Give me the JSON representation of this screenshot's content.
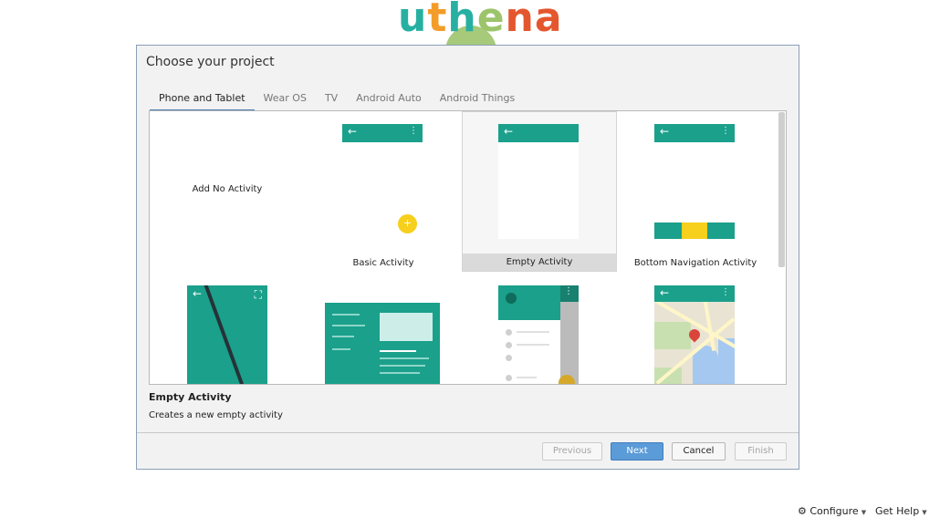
{
  "brand": {
    "letters": [
      {
        "ch": "u",
        "color": "#27b0a2"
      },
      {
        "ch": "t",
        "color": "#f39c2a"
      },
      {
        "ch": "h",
        "color": "#27b0a2"
      },
      {
        "ch": "e",
        "color": "#9cc46a"
      },
      {
        "ch": "n",
        "color": "#e4572e"
      },
      {
        "ch": "a",
        "color": "#e4572e"
      }
    ]
  },
  "dialog": {
    "title": "Choose your project",
    "tabs": [
      {
        "label": "Phone and Tablet",
        "active": true
      },
      {
        "label": "Wear OS",
        "active": false
      },
      {
        "label": "TV",
        "active": false
      },
      {
        "label": "Android Auto",
        "active": false
      },
      {
        "label": "Android Things",
        "active": false
      }
    ],
    "templates": [
      {
        "label": "Add No Activity"
      },
      {
        "label": "Basic Activity"
      },
      {
        "label": "Empty Activity",
        "selected": true
      },
      {
        "label": "Bottom Navigation Activity"
      }
    ],
    "icons": {
      "back": "←",
      "overflow": "⋮",
      "fab_plus": "+",
      "expand": "⛶"
    },
    "description": {
      "title": "Empty Activity",
      "text": "Creates a new empty activity"
    },
    "buttons": {
      "previous": "Previous",
      "next": "Next",
      "cancel": "Cancel",
      "finish": "Finish"
    }
  },
  "footer": {
    "configure": "Configure",
    "get_help": "Get Help",
    "gear_glyph": "⚙",
    "caret_glyph": "▼"
  },
  "colors": {
    "teal": "#1aa08b",
    "yellow": "#f7cf1d",
    "primary_button": "#5b9bd8"
  }
}
